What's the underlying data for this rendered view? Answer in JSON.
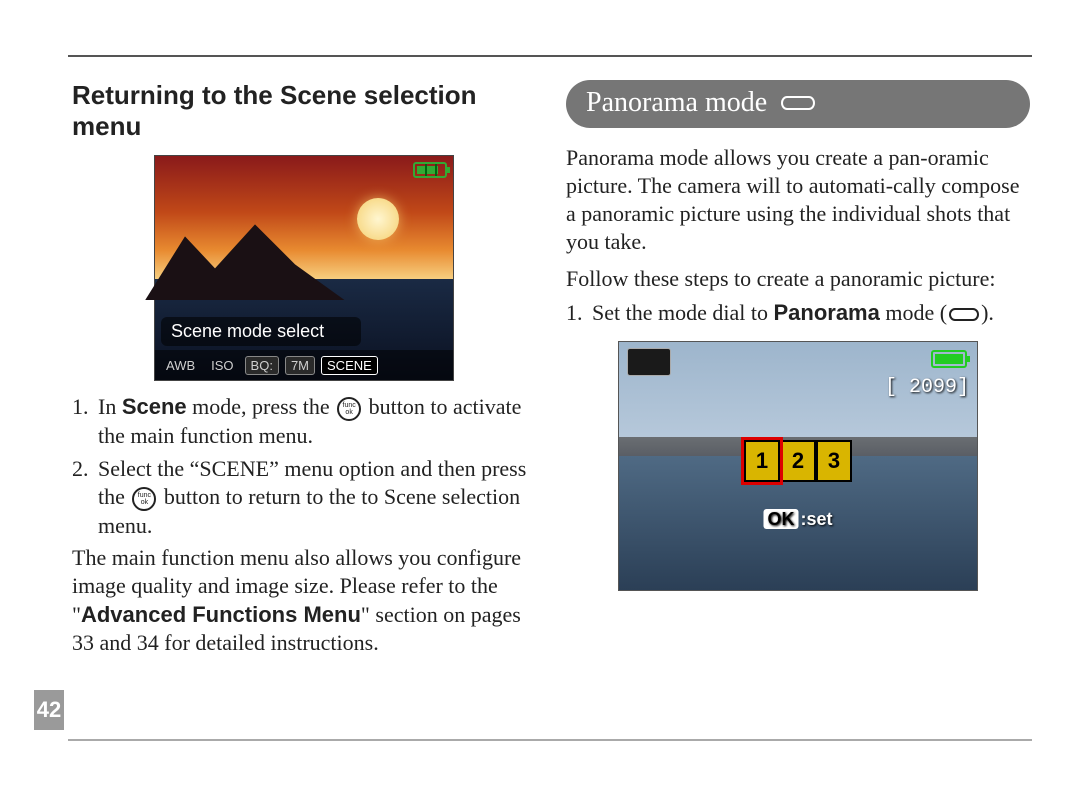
{
  "page_number": "42",
  "left": {
    "heading": "Returning to the Scene selection menu",
    "fig1": {
      "banner": "Scene mode select",
      "tags": [
        "AWB",
        "ISO",
        "BQ:",
        "7M",
        "SCENE"
      ],
      "battery_level": "3-bars"
    },
    "item1_pre": "In ",
    "item1_boldA": "Scene",
    "item1_mid": " mode, press the ",
    "item1_post": " button to activate the main function menu.",
    "item2_pre": "Select the “SCENE” menu option and then press the ",
    "item2_post": " button to return to the to Scene selection menu.",
    "para_pre": "The main function menu also allows you configure image quality and image size. Please refer to the \"",
    "para_bold": "Advanced Functions Menu",
    "para_post": "\" section on pages 33 and 34 for detailed instructions."
  },
  "right": {
    "section_title": "Panorama mode",
    "intro": "Panorama mode allows you create a pan-oramic picture.  The camera will  to automati-cally compose a panoramic picture using the individual shots that you take.",
    "follow": "Follow these steps to create a panoramic picture:",
    "step1_pre": "Set the mode dial to ",
    "step1_bold": "Panorama",
    "step1_mid": " mode (",
    "step1_post": ").",
    "fig2": {
      "counter": "[ 2099]",
      "frames": [
        "1",
        "2",
        "3"
      ],
      "ok_label": "OK",
      "set_label": ":set"
    }
  },
  "icons": {
    "func_top": "func",
    "func_bottom": "ok"
  }
}
